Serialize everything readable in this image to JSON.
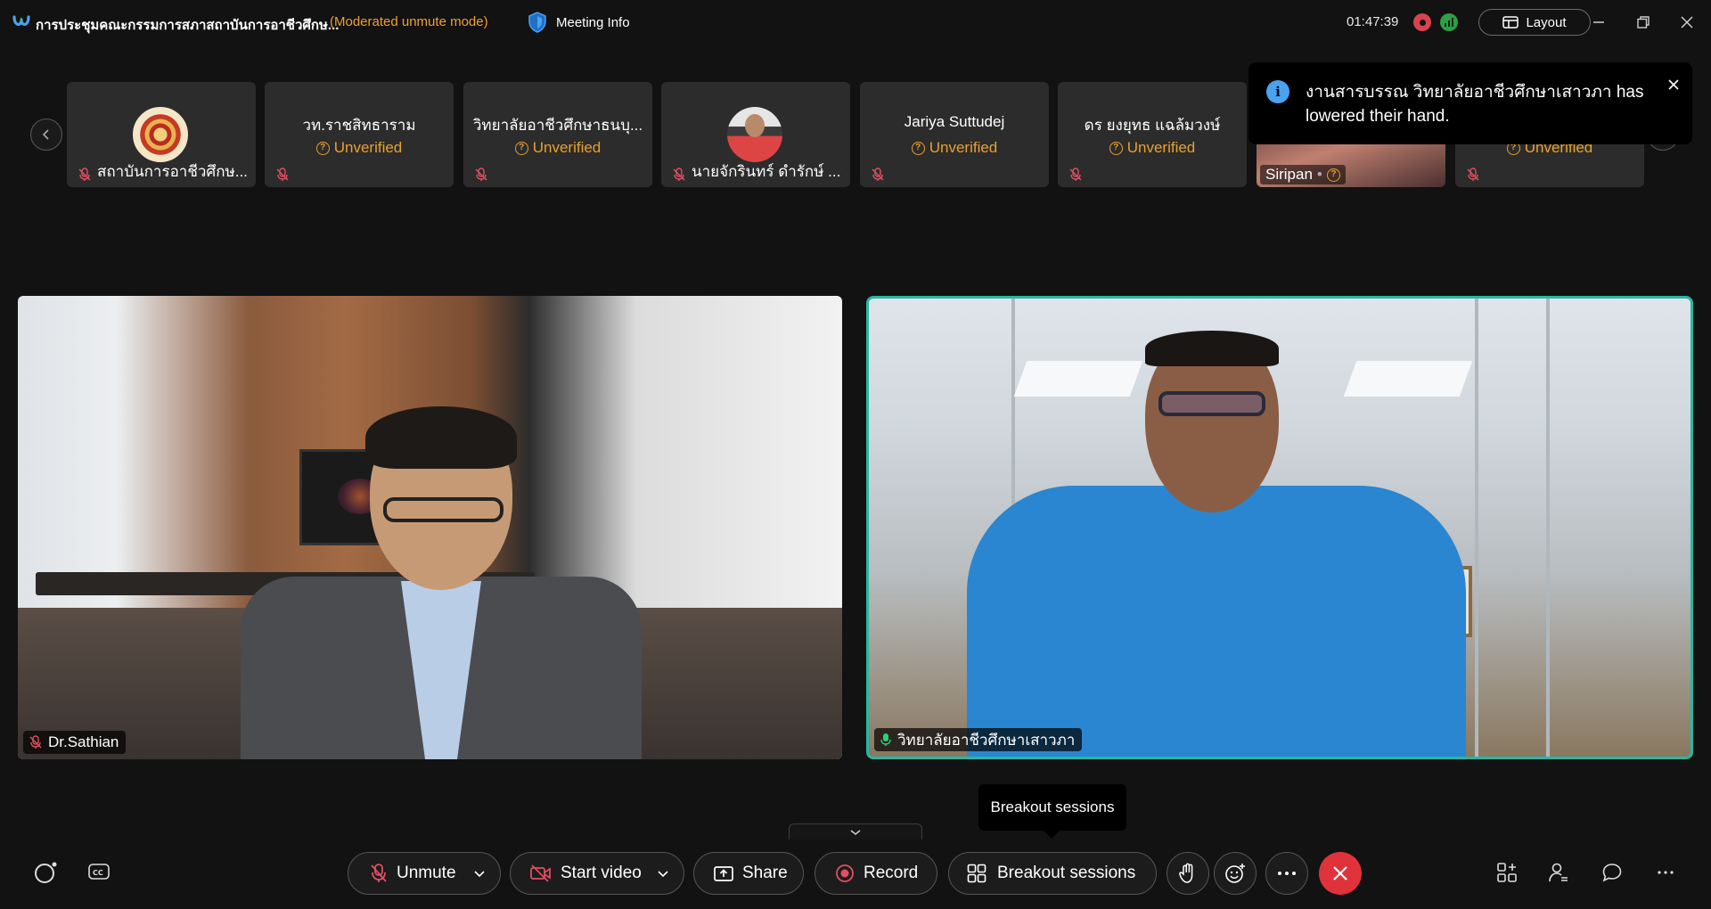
{
  "titlebar": {
    "meeting_title": "การประชุมคณะกรรมการสภาสถาบันการอาชีวศึกษ...",
    "mode": "(Moderated unmute mode)",
    "meeting_info": "Meeting Info",
    "timer": "01:47:39",
    "layout_label": "Layout"
  },
  "participants": [
    {
      "name": "สถาบันการอาชีวศึกษ...",
      "avatar": "emblem-avatar"
    },
    {
      "name": "วท.ราชสิทธาราม",
      "status": "Unverified"
    },
    {
      "name": "วิทยาลัยอาชีวศึกษาธนบุ...",
      "status": "Unverified"
    },
    {
      "name": "นายจักรินทร์ ดำรักษ์ ...",
      "avatar": "photo-avatar"
    },
    {
      "name": "Jariya Suttudej",
      "status": "Unverified"
    },
    {
      "name": "ดร ยงยุทธ แฉล้มวงษ์",
      "status": "Unverified"
    },
    {
      "name": "Siripan",
      "video": true
    },
    {
      "name": "",
      "status": "Unverified"
    }
  ],
  "notification": {
    "message": "งานสารบรรณ วิทยาลัยอาชีวศึกษาเสาวภา has lowered their hand."
  },
  "videos": {
    "left": {
      "name": "Dr.Sathian",
      "muted": true
    },
    "right": {
      "name": "วิทยาลัยอาชีวศึกษาเสาวภา",
      "speaking": true
    }
  },
  "controls": {
    "unmute": "Unmute",
    "start_video": "Start video",
    "share": "Share",
    "record": "Record",
    "breakout": "Breakout sessions",
    "tooltip": "Breakout sessions"
  },
  "colors": {
    "accent_speaker": "#29b6a0",
    "warning": "#e8a030",
    "end_call": "#e0323b",
    "muted_icon": "#e05060"
  }
}
